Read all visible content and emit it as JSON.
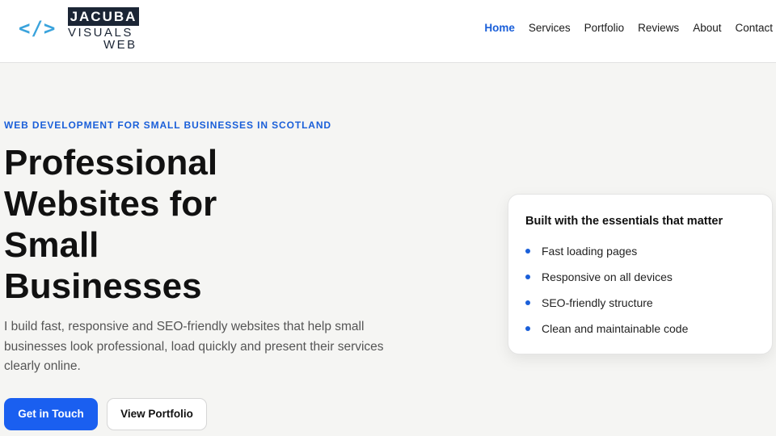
{
  "logo": {
    "mark": "</>",
    "line1": "JACUBA",
    "line2": "VISUALS",
    "line3": "WEB"
  },
  "nav": {
    "items": [
      "Home",
      "Services",
      "Portfolio",
      "Reviews",
      "About",
      "Contact"
    ],
    "active": "Home"
  },
  "hero": {
    "eyebrow": "WEB DEVELOPMENT FOR SMALL BUSINESSES IN SCOTLAND",
    "title": "Professional Websites for Small Businesses",
    "lead": "I build fast, responsive and SEO-friendly websites that help small businesses look professional, load quickly and present their services clearly online.",
    "primary_button": "Get in Touch",
    "secondary_button": "View Portfolio"
  },
  "card": {
    "title": "Built with the essentials that matter",
    "items": [
      "Fast loading pages",
      "Responsive on all devices",
      "SEO-friendly structure",
      "Clean and maintainable code"
    ]
  },
  "colors": {
    "accent": "#1a5fd9",
    "button": "#1a5ff0",
    "logo_mark": "#3aa3dc",
    "logo_box": "#1b2535"
  }
}
